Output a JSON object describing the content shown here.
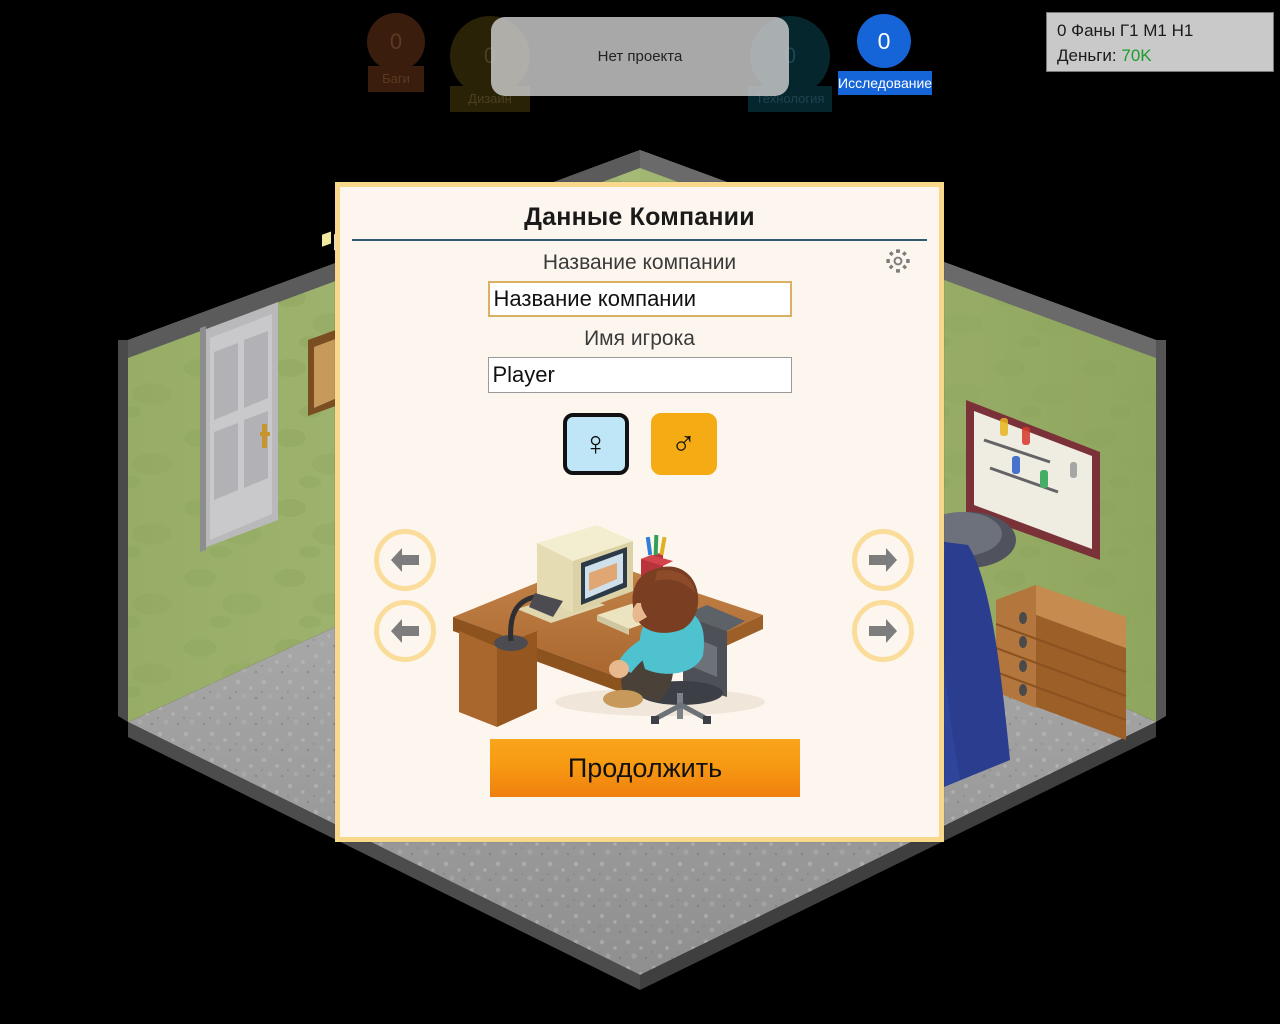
{
  "hud": {
    "project_bar_text": "Нет проекта",
    "indicators": [
      {
        "name": "bugs",
        "value": "0",
        "label": "Баги",
        "circle_color": "#3a1d0c",
        "label_color": "#3a1d0c",
        "text_color": "#5a3a22",
        "dimmed": true
      },
      {
        "name": "design",
        "value": "0",
        "label": "Дизайн",
        "circle_color": "#2a2206",
        "label_color": "#2a2206",
        "text_color": "#4a4020",
        "dimmed": true
      },
      {
        "name": "technology",
        "value": "0",
        "label": "Технология",
        "circle_color": "#06262e",
        "label_color": "#06262e",
        "text_color": "#1d4450",
        "dimmed": true
      },
      {
        "name": "research",
        "value": "0",
        "label": "Исследование",
        "circle_color": "#1565d8",
        "label_color": "#1565d8",
        "text_color": "#ffffff",
        "dimmed": false
      }
    ],
    "stats_line1": "0 Фаны Г1 М1 Н1",
    "money_label": "Деньги:",
    "money_value": "70K"
  },
  "dialog": {
    "title": "Данные Компании",
    "company_label": "Название компании",
    "company_value": "Название компании",
    "company_placeholder": "Название компании",
    "player_label": "Имя игрока",
    "player_value": "Player",
    "player_placeholder": "Player",
    "settings_icon": "gear-icon",
    "gender": {
      "female_glyph": "♀",
      "male_glyph": "♂",
      "selected": "female"
    },
    "nav": {
      "prev_hair_icon": "arrow-left-icon",
      "prev_skin_icon": "arrow-left-icon",
      "next_hair_icon": "arrow-right-icon",
      "next_skin_icon": "arrow-right-icon"
    },
    "continue_label": "Продолжить",
    "accent_border": "#f8d88a",
    "panel_bg": "#fdf6ee",
    "rule_color": "#31586e",
    "continue_color": "#f79a12"
  },
  "scene": {
    "name": "isometric-office-room",
    "wall_color": "#9ab06a",
    "floor_color": "#9d9d9d",
    "door": "gray-panel-door",
    "corkboard": "brown-corkboard",
    "whiteboard": "whiteboard-with-markers",
    "dresser": "wooden-dresser",
    "bed": "blue-bed",
    "desk": "wooden-desk",
    "computer": "crt-computer",
    "chair": "office-chair",
    "character_shirt": "#4fc2cf",
    "character_hair": "#7a3f22"
  }
}
